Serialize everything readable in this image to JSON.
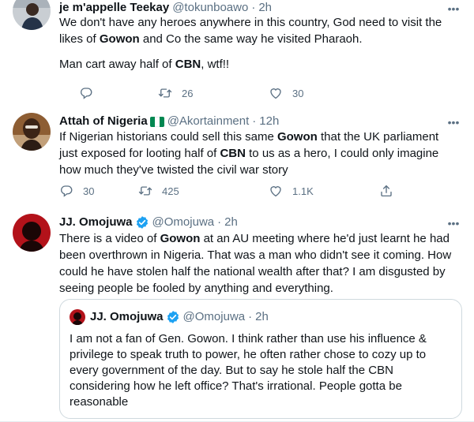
{
  "tweets": [
    {
      "name": "je m'appelle Teekay",
      "handle": "@tokunboawo",
      "separator": "·",
      "time": "2h",
      "text_line1": "We don't have any heroes anywhere in this country, God need to visit the",
      "text_line2_a": "likes of ",
      "text_line2_bold": "Gowon",
      "text_line2_b": " and Co the same way he visited Pharaoh.",
      "text_line3_a": "Man cart away half of ",
      "text_line3_bold": "CBN",
      "text_line3_b": ", wtf!!",
      "reply_count": "",
      "retweet_count": "26",
      "like_count": "30"
    },
    {
      "name": "Attah of Nigeria",
      "handle": "@Akortainment",
      "separator": "·",
      "time": "12h",
      "flag_colors": [
        "#008751",
        "#ffffff",
        "#008751"
      ],
      "text_1": "If Nigerian historians could sell this same ",
      "text_bold_1": "Gowon",
      "text_2": " that the UK parliament just exposed for looting half of ",
      "text_bold_2": "CBN",
      "text_3": " to us as a hero, I could only imagine how much they've twisted the civil war story",
      "reply_count": "30",
      "retweet_count": "425",
      "like_count": "1.1K"
    },
    {
      "name": "JJ. Omojuwa",
      "handle": "@Omojuwa",
      "separator": "·",
      "time": "2h",
      "text_1": "There is a video of ",
      "text_bold_1": "Gowon",
      "text_2": " at an AU meeting where he'd just learnt he had been overthrown in Nigeria. That was a man who didn't see it coming. How could he have stolen half the national wealth after that? I am disgusted by seeing people be fooled by anything and everything.",
      "quote": {
        "name": "JJ. Omojuwa",
        "handle": "@Omojuwa",
        "separator": "·",
        "time": "2h",
        "text": "I am not a fan of Gen. Gowon. I think rather than use his influence & privilege to speak truth to power, he often rather chose to cozy up to every government of the day. But to say he stole half the CBN considering how he left office? That's irrational. People gotta be reasonable"
      }
    }
  ],
  "more_glyph": "•••",
  "colors": {
    "text": "#0f1419",
    "secondary": "#5b7083",
    "verified": "#1da1f2",
    "divider": "#e6ecf0"
  },
  "icons": [
    "reply-icon",
    "retweet-icon",
    "like-icon",
    "share-icon",
    "verified-badge-icon",
    "more-options-icon",
    "nigeria-flag-icon"
  ]
}
